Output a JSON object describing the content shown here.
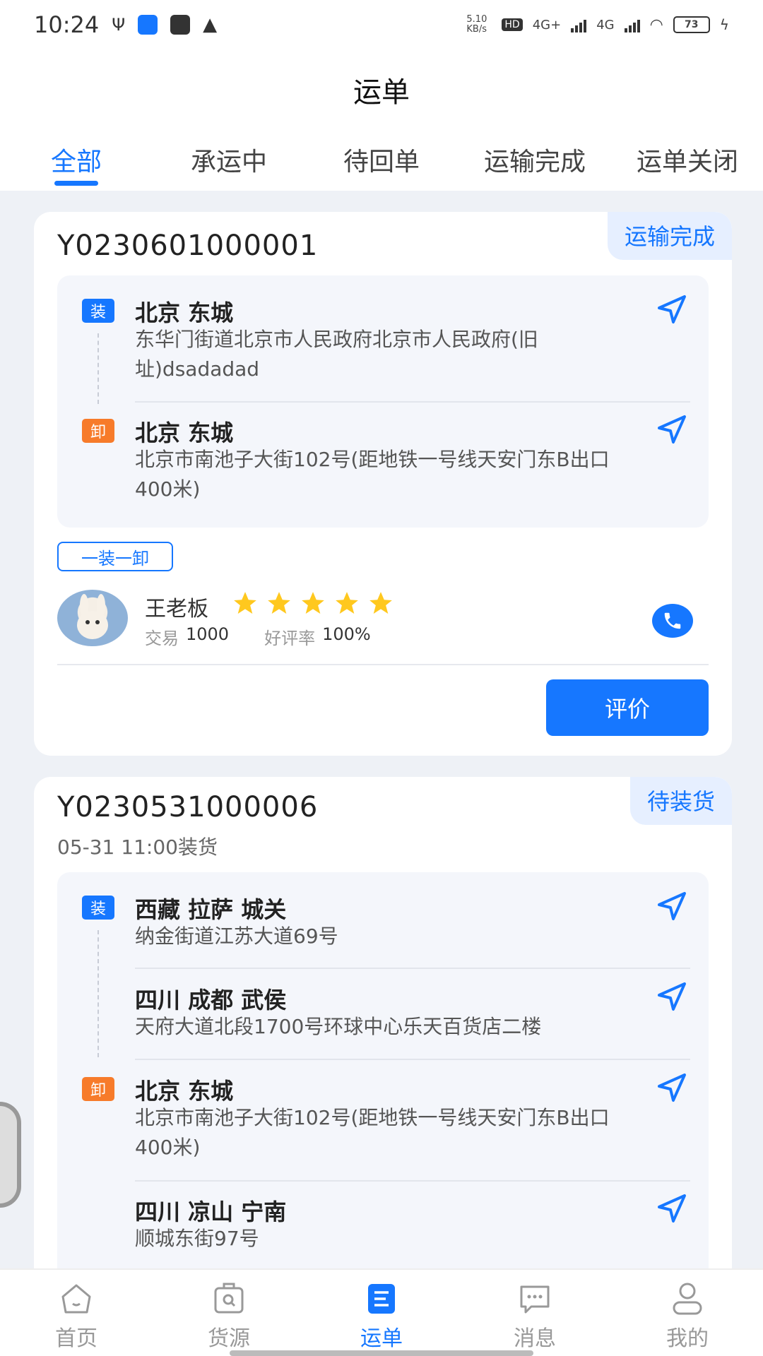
{
  "status_bar": {
    "time": "10:24",
    "net_speed": "5.10 KB/s",
    "hd": "HD",
    "sig1": "4G+",
    "sig2": "4G",
    "battery": "73"
  },
  "header": {
    "title": "运单"
  },
  "tabs": [
    {
      "label": "全部",
      "active": true
    },
    {
      "label": "承运中"
    },
    {
      "label": "待回单"
    },
    {
      "label": "运输完成"
    },
    {
      "label": "运单关闭"
    }
  ],
  "orders": [
    {
      "id": "Y0230601000001",
      "status": "运输完成",
      "stops": [
        {
          "tag": "装",
          "city": "北京 东城",
          "address": "东华门街道北京市人民政府北京市人民政府(旧址)dsadadad"
        },
        {
          "tag": "卸",
          "city": "北京 东城",
          "address": "北京市南池子大街102号(距地铁一号线天安门东B出口400米)"
        }
      ],
      "service_type": "一装一卸",
      "owner": {
        "name": "王老板",
        "rating_stars": 5,
        "trade_label": "交易",
        "trade_count": "1000",
        "praise_label": "好评率",
        "praise_rate": "100%"
      },
      "action": "评价"
    },
    {
      "id": "Y0230531000006",
      "status": "待装货",
      "load_time": "05-31 11:00装货",
      "stops": [
        {
          "tag": "装",
          "city": "西藏 拉萨 城关",
          "address": "纳金街道江苏大道69号"
        },
        {
          "tag": "",
          "city": "四川 成都 武侯",
          "address": "天府大道北段1700号环球中心乐天百货店二楼"
        },
        {
          "tag": "卸",
          "city": "北京 东城",
          "address": "北京市南池子大街102号(距地铁一号线天安门东B出口400米)"
        },
        {
          "tag": "",
          "city": "四川 凉山 宁南",
          "address": "顺城东街97号"
        }
      ]
    }
  ],
  "tabbar": [
    {
      "label": "首页",
      "icon": "home-icon"
    },
    {
      "label": "货源",
      "icon": "cargo-icon"
    },
    {
      "label": "运单",
      "icon": "waybill-icon",
      "active": true
    },
    {
      "label": "消息",
      "icon": "message-icon"
    },
    {
      "label": "我的",
      "icon": "profile-icon"
    }
  ],
  "colors": {
    "accent": "#1677ff",
    "unload": "#f77b2a",
    "star": "#ffc81e"
  }
}
